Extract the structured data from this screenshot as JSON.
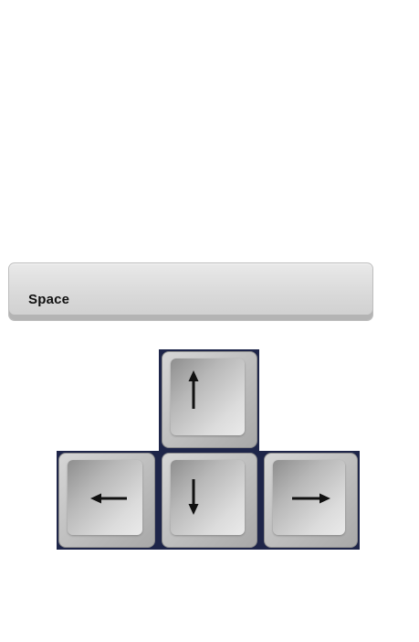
{
  "keyboard": {
    "space_label": "Space",
    "arrow_keys": {
      "up": {
        "icon": "arrow-up-icon"
      },
      "left": {
        "icon": "arrow-left-icon"
      },
      "down": {
        "icon": "arrow-down-icon"
      },
      "right": {
        "icon": "arrow-right-icon"
      }
    }
  },
  "colors": {
    "key_plate": "#1e2549",
    "space_key": "#d9d9d9",
    "arrow_glyph": "#111111",
    "label_text": "#111111"
  }
}
